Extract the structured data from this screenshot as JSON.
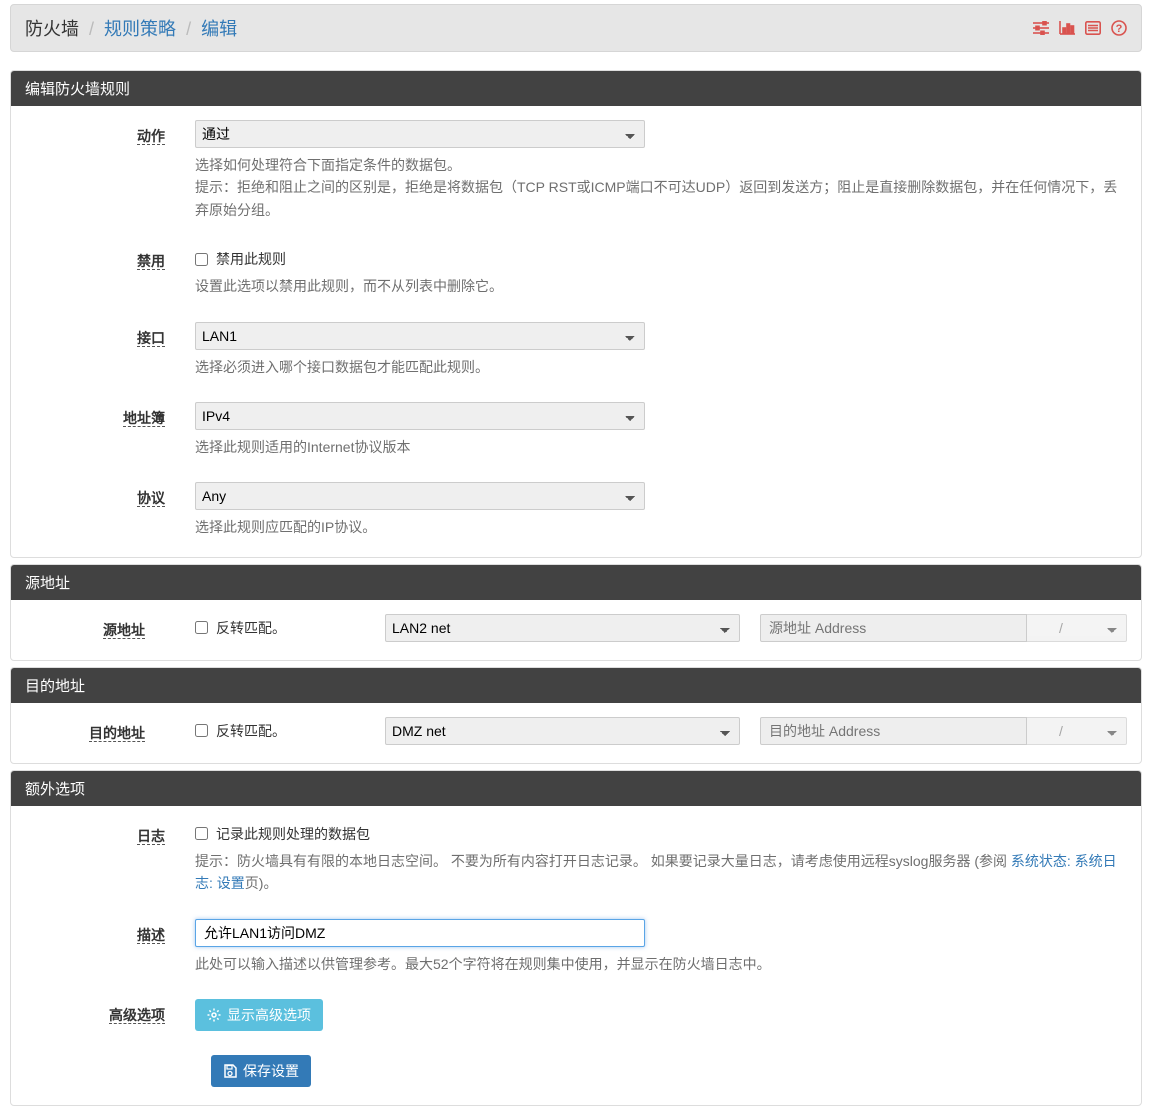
{
  "breadcrumb": {
    "p1": "防火墙",
    "p2": "规则策略",
    "p3": "编辑"
  },
  "panels": {
    "edit": "编辑防火墙规则",
    "source": "源地址",
    "dest": "目的地址",
    "extra": "额外选项"
  },
  "labels": {
    "action": "动作",
    "disable": "禁用",
    "interface": "接口",
    "addrbook": "地址簿",
    "proto": "协议",
    "source": "源地址",
    "dest": "目的地址",
    "log": "日志",
    "desc": "描述",
    "adv": "高级选项"
  },
  "values": {
    "action": "通过",
    "interface": "LAN1",
    "addrbook": "IPv4",
    "proto": "Any",
    "sourceNet": "LAN2 net",
    "destNet": "DMZ net",
    "mask": "/",
    "desc": "允许LAN1访问DMZ"
  },
  "placeholders": {
    "sourceAddr": "源地址 Address",
    "destAddr": "目的地址 Address"
  },
  "check": {
    "disable": "禁用此规则",
    "invert": "反转匹配。",
    "log": "记录此规则处理的数据包"
  },
  "help": {
    "action1": "选择如何处理符合下面指定条件的数据包。",
    "action2": "提示：拒绝和阻止之间的区别是，拒绝是将数据包（TCP RST或ICMP端口不可达UDP）返回到发送方；阻止是直接删除数据包，并在任何情况下，丢弃原始分组。",
    "disable": "设置此选项以禁用此规则，而不从列表中删除它。",
    "interface": "选择必须进入哪个接口数据包才能匹配此规则。",
    "addrbook": "选择此规则适用的Internet协议版本",
    "proto": "选择此规则应匹配的IP协议。",
    "log1": "提示：防火墙具有有限的本地日志空间。 不要为所有内容打开日志记录。 如果要记录大量日志，请考虑使用远程syslog服务器 (参阅 ",
    "logLink": "系统状态: 系统日志: 设置",
    "log2": "页)。",
    "desc": "此处可以输入描述以供管理参考。最大52个字符将在规则集中使用，并显示在防火墙日志中。"
  },
  "buttons": {
    "showAdv": "显示高级选项",
    "save": "保存设置"
  }
}
